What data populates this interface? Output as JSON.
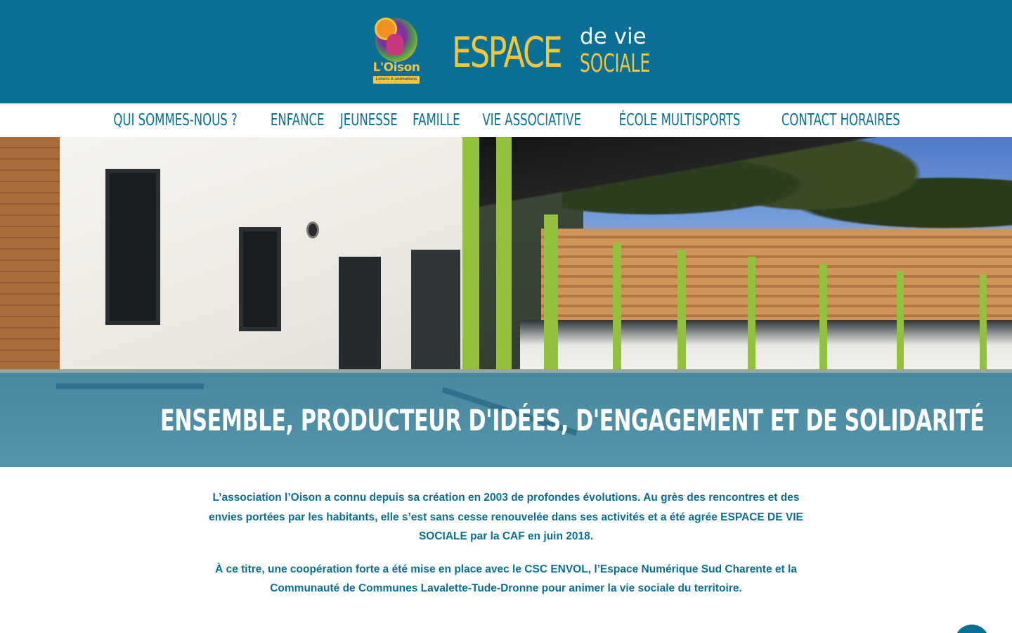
{
  "header": {
    "logo": {
      "name": "L'Oison",
      "tagline": "Loisirs & animations"
    },
    "brand": {
      "main": "ESPACE",
      "top": "de vie",
      "bottom": "SOCIALE"
    }
  },
  "nav": {
    "items": [
      "QUI SOMMES-NOUS ?",
      "ENFANCE",
      "JEUNESSE",
      "FAMILLE",
      "VIE ASSOCIATIVE",
      "ÉCOLE MULTISPORTS",
      "CONTACT HORAIRES"
    ]
  },
  "hero": {
    "title": "ENSEMBLE, PRODUCTEUR D'IDÉES, D'ENGAGEMENT ET DE SOLIDARITÉ"
  },
  "content": {
    "paragraphs": [
      "L’association l’Oison a connu depuis sa création en 2003 de profondes évolutions. Au grès des rencontres et des envies portées par les habitants, elle s’est sans cesse renouvelée dans ses activités et a été agrée ESPACE DE VIE SOCIALE par la CAF en juin 2018.",
      "À ce titre, une coopération forte a été mise en place avec le CSC ENVOL, l’Espace Numérique Sud Charente et la Communauté de Communes Lavalette-Tude-Dronne pour animer la vie sociale du territoire."
    ]
  },
  "colors": {
    "primary": "#0a6f96",
    "accent": "#f0c63d",
    "white": "#ffffff"
  },
  "icons": {
    "chat": "chat-icon"
  }
}
